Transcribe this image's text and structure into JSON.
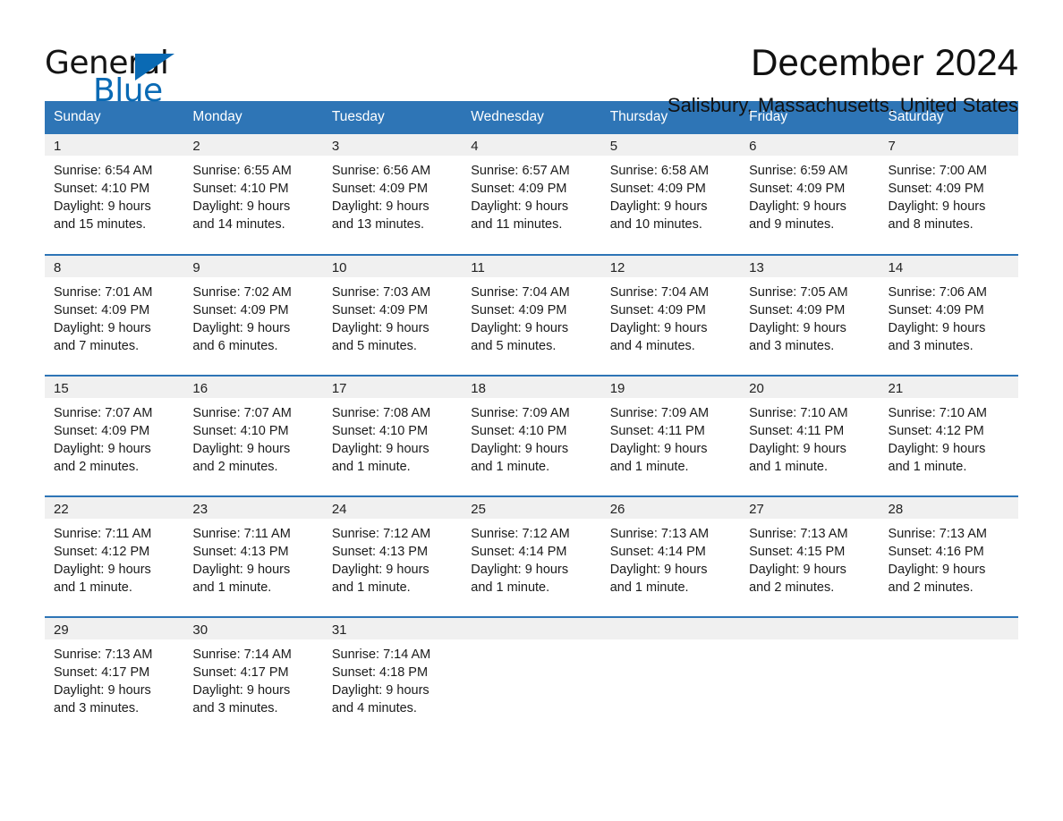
{
  "brand": {
    "name_top": "General",
    "name_bottom": "Blue",
    "accent_color": "#0a6ab4"
  },
  "header": {
    "month_title": "December 2024",
    "location": "Salisbury, Massachusetts, United States"
  },
  "theme": {
    "header_blue": "#2e75b6",
    "daynum_band": "#f0f0f0",
    "page_background": "#ffffff",
    "text": "#1a1a1a"
  },
  "weekday_headers": [
    "Sunday",
    "Monday",
    "Tuesday",
    "Wednesday",
    "Thursday",
    "Friday",
    "Saturday"
  ],
  "weeks": [
    [
      {
        "day": "1",
        "sunrise": "Sunrise: 6:54 AM",
        "sunset": "Sunset: 4:10 PM",
        "daylight_line1": "Daylight: 9 hours",
        "daylight_line2": "and 15 minutes."
      },
      {
        "day": "2",
        "sunrise": "Sunrise: 6:55 AM",
        "sunset": "Sunset: 4:10 PM",
        "daylight_line1": "Daylight: 9 hours",
        "daylight_line2": "and 14 minutes."
      },
      {
        "day": "3",
        "sunrise": "Sunrise: 6:56 AM",
        "sunset": "Sunset: 4:09 PM",
        "daylight_line1": "Daylight: 9 hours",
        "daylight_line2": "and 13 minutes."
      },
      {
        "day": "4",
        "sunrise": "Sunrise: 6:57 AM",
        "sunset": "Sunset: 4:09 PM",
        "daylight_line1": "Daylight: 9 hours",
        "daylight_line2": "and 11 minutes."
      },
      {
        "day": "5",
        "sunrise": "Sunrise: 6:58 AM",
        "sunset": "Sunset: 4:09 PM",
        "daylight_line1": "Daylight: 9 hours",
        "daylight_line2": "and 10 minutes."
      },
      {
        "day": "6",
        "sunrise": "Sunrise: 6:59 AM",
        "sunset": "Sunset: 4:09 PM",
        "daylight_line1": "Daylight: 9 hours",
        "daylight_line2": "and 9 minutes."
      },
      {
        "day": "7",
        "sunrise": "Sunrise: 7:00 AM",
        "sunset": "Sunset: 4:09 PM",
        "daylight_line1": "Daylight: 9 hours",
        "daylight_line2": "and 8 minutes."
      }
    ],
    [
      {
        "day": "8",
        "sunrise": "Sunrise: 7:01 AM",
        "sunset": "Sunset: 4:09 PM",
        "daylight_line1": "Daylight: 9 hours",
        "daylight_line2": "and 7 minutes."
      },
      {
        "day": "9",
        "sunrise": "Sunrise: 7:02 AM",
        "sunset": "Sunset: 4:09 PM",
        "daylight_line1": "Daylight: 9 hours",
        "daylight_line2": "and 6 minutes."
      },
      {
        "day": "10",
        "sunrise": "Sunrise: 7:03 AM",
        "sunset": "Sunset: 4:09 PM",
        "daylight_line1": "Daylight: 9 hours",
        "daylight_line2": "and 5 minutes."
      },
      {
        "day": "11",
        "sunrise": "Sunrise: 7:04 AM",
        "sunset": "Sunset: 4:09 PM",
        "daylight_line1": "Daylight: 9 hours",
        "daylight_line2": "and 5 minutes."
      },
      {
        "day": "12",
        "sunrise": "Sunrise: 7:04 AM",
        "sunset": "Sunset: 4:09 PM",
        "daylight_line1": "Daylight: 9 hours",
        "daylight_line2": "and 4 minutes."
      },
      {
        "day": "13",
        "sunrise": "Sunrise: 7:05 AM",
        "sunset": "Sunset: 4:09 PM",
        "daylight_line1": "Daylight: 9 hours",
        "daylight_line2": "and 3 minutes."
      },
      {
        "day": "14",
        "sunrise": "Sunrise: 7:06 AM",
        "sunset": "Sunset: 4:09 PM",
        "daylight_line1": "Daylight: 9 hours",
        "daylight_line2": "and 3 minutes."
      }
    ],
    [
      {
        "day": "15",
        "sunrise": "Sunrise: 7:07 AM",
        "sunset": "Sunset: 4:09 PM",
        "daylight_line1": "Daylight: 9 hours",
        "daylight_line2": "and 2 minutes."
      },
      {
        "day": "16",
        "sunrise": "Sunrise: 7:07 AM",
        "sunset": "Sunset: 4:10 PM",
        "daylight_line1": "Daylight: 9 hours",
        "daylight_line2": "and 2 minutes."
      },
      {
        "day": "17",
        "sunrise": "Sunrise: 7:08 AM",
        "sunset": "Sunset: 4:10 PM",
        "daylight_line1": "Daylight: 9 hours",
        "daylight_line2": "and 1 minute."
      },
      {
        "day": "18",
        "sunrise": "Sunrise: 7:09 AM",
        "sunset": "Sunset: 4:10 PM",
        "daylight_line1": "Daylight: 9 hours",
        "daylight_line2": "and 1 minute."
      },
      {
        "day": "19",
        "sunrise": "Sunrise: 7:09 AM",
        "sunset": "Sunset: 4:11 PM",
        "daylight_line1": "Daylight: 9 hours",
        "daylight_line2": "and 1 minute."
      },
      {
        "day": "20",
        "sunrise": "Sunrise: 7:10 AM",
        "sunset": "Sunset: 4:11 PM",
        "daylight_line1": "Daylight: 9 hours",
        "daylight_line2": "and 1 minute."
      },
      {
        "day": "21",
        "sunrise": "Sunrise: 7:10 AM",
        "sunset": "Sunset: 4:12 PM",
        "daylight_line1": "Daylight: 9 hours",
        "daylight_line2": "and 1 minute."
      }
    ],
    [
      {
        "day": "22",
        "sunrise": "Sunrise: 7:11 AM",
        "sunset": "Sunset: 4:12 PM",
        "daylight_line1": "Daylight: 9 hours",
        "daylight_line2": "and 1 minute."
      },
      {
        "day": "23",
        "sunrise": "Sunrise: 7:11 AM",
        "sunset": "Sunset: 4:13 PM",
        "daylight_line1": "Daylight: 9 hours",
        "daylight_line2": "and 1 minute."
      },
      {
        "day": "24",
        "sunrise": "Sunrise: 7:12 AM",
        "sunset": "Sunset: 4:13 PM",
        "daylight_line1": "Daylight: 9 hours",
        "daylight_line2": "and 1 minute."
      },
      {
        "day": "25",
        "sunrise": "Sunrise: 7:12 AM",
        "sunset": "Sunset: 4:14 PM",
        "daylight_line1": "Daylight: 9 hours",
        "daylight_line2": "and 1 minute."
      },
      {
        "day": "26",
        "sunrise": "Sunrise: 7:13 AM",
        "sunset": "Sunset: 4:14 PM",
        "daylight_line1": "Daylight: 9 hours",
        "daylight_line2": "and 1 minute."
      },
      {
        "day": "27",
        "sunrise": "Sunrise: 7:13 AM",
        "sunset": "Sunset: 4:15 PM",
        "daylight_line1": "Daylight: 9 hours",
        "daylight_line2": "and 2 minutes."
      },
      {
        "day": "28",
        "sunrise": "Sunrise: 7:13 AM",
        "sunset": "Sunset: 4:16 PM",
        "daylight_line1": "Daylight: 9 hours",
        "daylight_line2": "and 2 minutes."
      }
    ],
    [
      {
        "day": "29",
        "sunrise": "Sunrise: 7:13 AM",
        "sunset": "Sunset: 4:17 PM",
        "daylight_line1": "Daylight: 9 hours",
        "daylight_line2": "and 3 minutes."
      },
      {
        "day": "30",
        "sunrise": "Sunrise: 7:14 AM",
        "sunset": "Sunset: 4:17 PM",
        "daylight_line1": "Daylight: 9 hours",
        "daylight_line2": "and 3 minutes."
      },
      {
        "day": "31",
        "sunrise": "Sunrise: 7:14 AM",
        "sunset": "Sunset: 4:18 PM",
        "daylight_line1": "Daylight: 9 hours",
        "daylight_line2": "and 4 minutes."
      },
      {
        "day": "",
        "sunrise": "",
        "sunset": "",
        "daylight_line1": "",
        "daylight_line2": ""
      },
      {
        "day": "",
        "sunrise": "",
        "sunset": "",
        "daylight_line1": "",
        "daylight_line2": ""
      },
      {
        "day": "",
        "sunrise": "",
        "sunset": "",
        "daylight_line1": "",
        "daylight_line2": ""
      },
      {
        "day": "",
        "sunrise": "",
        "sunset": "",
        "daylight_line1": "",
        "daylight_line2": ""
      }
    ]
  ]
}
